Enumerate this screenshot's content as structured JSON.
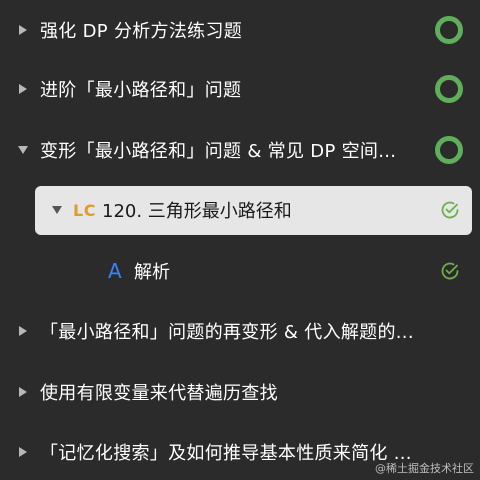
{
  "items": [
    {
      "title": "强化 DP 分析方法练习题",
      "expanded": false,
      "status": "ring"
    },
    {
      "title": "进阶「最小路径和」问题",
      "expanded": false,
      "status": "ring"
    },
    {
      "title": "变形「最小路径和」问题 & 常见 DP 空间...",
      "expanded": true,
      "status": "ring"
    },
    {
      "title": "「最小路径和」问题的再变形 & 代入解题的...",
      "expanded": false,
      "status": "none"
    },
    {
      "title": "使用有限变量来代替遍历查找",
      "expanded": false,
      "status": "none"
    },
    {
      "title": "「记忆化搜索」及如何推导基本性质来简化 ...",
      "expanded": false,
      "status": "none"
    }
  ],
  "selected_item": {
    "badge": "LC",
    "title": "120. 三角形最小路径和",
    "status": "check"
  },
  "child_item": {
    "badge": "A",
    "title": "解析",
    "status": "check"
  },
  "watermark": "@稀土掘金技术社区",
  "colors": {
    "background": "#2b2b2b",
    "ring": "#5fae5a",
    "check": "#6ab04c",
    "lc_badge": "#e39a2b",
    "a_badge": "#3b82f6",
    "selected_bg": "#e6e6e6"
  }
}
